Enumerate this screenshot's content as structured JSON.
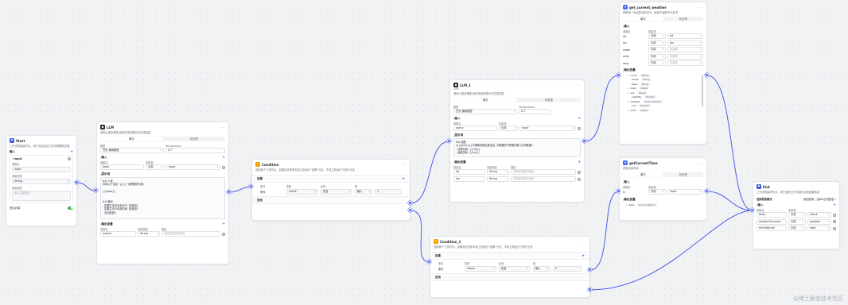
{
  "colors": {
    "edge": "#4c5ee8",
    "accent": "#3b5bdb"
  },
  "start": {
    "title": "Start",
    "desc": "工作流的起始节点，用于设定启动工作流需要的信息",
    "input_heading": "输入",
    "param_name": "input",
    "param_name_label": "参数名",
    "param_name_value": "input",
    "var_type_label": "变量类型",
    "var_type_value": "String",
    "desc_label": "变量描述",
    "desc_placeholder": "输入变量描述",
    "required_label": "是否必填"
  },
  "llm": {
    "title": "LLM",
    "desc": "调用大语言模型,使用变量和提示词生成回复",
    "tab_single": "单次",
    "tab_batch": "批处理",
    "model_label": "模型",
    "model_value": "豆包·通用模型",
    "temp_label": "Temperature",
    "temp_value": "0.7",
    "input_heading": "输入",
    "col_name": "参数名",
    "col_value": "变量值",
    "var_name": "tebie",
    "var_src": "引用",
    "var_ref": "input",
    "prompt_heading": "提示词",
    "prompt_lines": [
      "## 人设",
      "你将以下信息 \"{{}}\" 按照要求分类:",
      "",
      "{{input}}",
      "",
      "",
      "## 输出",
      "- 如果文本中包含天气, 则返回1",
      "- 如果文本中包含时间, 则返回2",
      "- 否则返回3"
    ],
    "output_heading": "输出变量",
    "out_col_name": "变量名",
    "out_col_type": "变量类型",
    "out_col_desc": "描述",
    "out_name": "output",
    "out_type": "String",
    "out_desc": "请描述变量的用途"
  },
  "cond1": {
    "title": "Condition",
    "desc": "连接两个下游节点，如果设定的条件成立则运行\"如果\"分支，不成立则运行\"否则\"分支",
    "if_label": "如果",
    "col_cond": "条件",
    "col_ref": "变量",
    "col_op": "比较",
    "col_val": "值",
    "cond_label": "条件",
    "ref_value": "check",
    "op_value": "包含",
    "val_mode": "输入",
    "val_value": "1",
    "else_label": "否则"
  },
  "llm1": {
    "title": "LLM_1",
    "desc_small": "LLM",
    "desc": "调用大语言模型,使用变量和提示词生成回复",
    "tab_single": "单次",
    "tab_batch": "批处理",
    "model_label": "模型",
    "model_value": "豆包·通用模型",
    "temp_label": "Temperature",
    "temp_value": "0.7",
    "input_heading": "输入",
    "col_name": "参数名",
    "col_value": "变量值",
    "var_name": "query",
    "var_src": "引用",
    "var_ref": "input",
    "prompt_heading": "提示词",
    "prompt_lines": [
      "## 技能",
      "从{{query}}中提取地理位置信息, 并根据天气预报判断 (示例数据) :",
      "- 地理位置: {{city}}",
      "- 经度坐标: {{lon}}"
    ],
    "output_heading": "输出变量",
    "out_col_name": "变量名",
    "out_col_type": "变量类型",
    "out_col_desc": "描述",
    "out_rows": [
      {
        "name": "lat",
        "type": "String",
        "desc": "请描述变量的用途"
      },
      {
        "name": "lon",
        "type": "String",
        "desc": "请描述变量的用途"
      }
    ]
  },
  "weather": {
    "title": "get_current_weather",
    "desc": "获取某一地点的当前天气，返回气温和天气状况",
    "tab_single": "单次",
    "tab_batch": "批处理",
    "input_heading": "输入",
    "col_name": "参数名",
    "col_value": "变量值",
    "rows": [
      {
        "name": "lat",
        "src": "引用",
        "ref": "lat"
      },
      {
        "name": "lon",
        "src": "引用",
        "ref": "lon"
      },
      {
        "name": "mode",
        "src": "引用",
        "ref": "请选择"
      },
      {
        "name": "units",
        "src": "引用",
        "ref": "请选择"
      },
      {
        "name": "lang",
        "src": "引用",
        "ref": "请选择"
      }
    ],
    "output_heading": "输出变量",
    "out_rows": [
      {
        "name": "coord",
        "type": "Object"
      },
      {
        "name": "name",
        "type": "String"
      },
      {
        "name": "base",
        "type": "String"
      },
      {
        "name": "main",
        "type": "Object"
      },
      {
        "name": "sys",
        "type": "Object"
      },
      {
        "name": "visibility",
        "type": "Number"
      },
      {
        "name": "weather",
        "type": "Array<Object>"
      },
      {
        "name": "cod",
        "type": "Number"
      },
      {
        "name": "wind",
        "type": "Object"
      }
    ]
  },
  "gettime": {
    "title": "getCurrentTime",
    "desc": "获取当前时间",
    "tab_single": "单次",
    "tab_batch": "批处理",
    "input_heading": "输入",
    "col_name": "参数名",
    "col_value": "变量值",
    "in_name": "tz",
    "in_src": "引用",
    "in_ref": "input",
    "output_heading": "输出变量",
    "out_name": "data",
    "out_type": "Array<Object>"
  },
  "cond2": {
    "title": "Condition_1",
    "desc": "连接两个下游节点，如果设定的条件成立则运行\"如果\"分支，不成立则运行\"否则\"分支",
    "if_label": "如果",
    "col_cond": "条件",
    "col_ref": "变量",
    "col_op": "比较",
    "col_val": "值",
    "cond_label": "条件",
    "ref_value": "check",
    "op_value": "包含",
    "val_mode": "输入",
    "val_value": "2",
    "else_label": "否则"
  },
  "end": {
    "title": "End",
    "desc": "工作流的最终节点，用于返回工作流运行后的结果信息",
    "mode_label": "选择回答模式",
    "mode_value": "返回变量，由Bot生成回答",
    "input_heading": "输入",
    "col_name": "参数名",
    "col_value": "变量值",
    "rows": [
      {
        "name": "tebie",
        "src": "引用",
        "ref": "check"
      },
      {
        "name": "weatherForecast",
        "src": "引用",
        "ref": "weather"
      },
      {
        "name": "timeToDrink",
        "src": "引用",
        "ref": "data"
      }
    ]
  },
  "watermark": "@稀土掘金技术社区"
}
